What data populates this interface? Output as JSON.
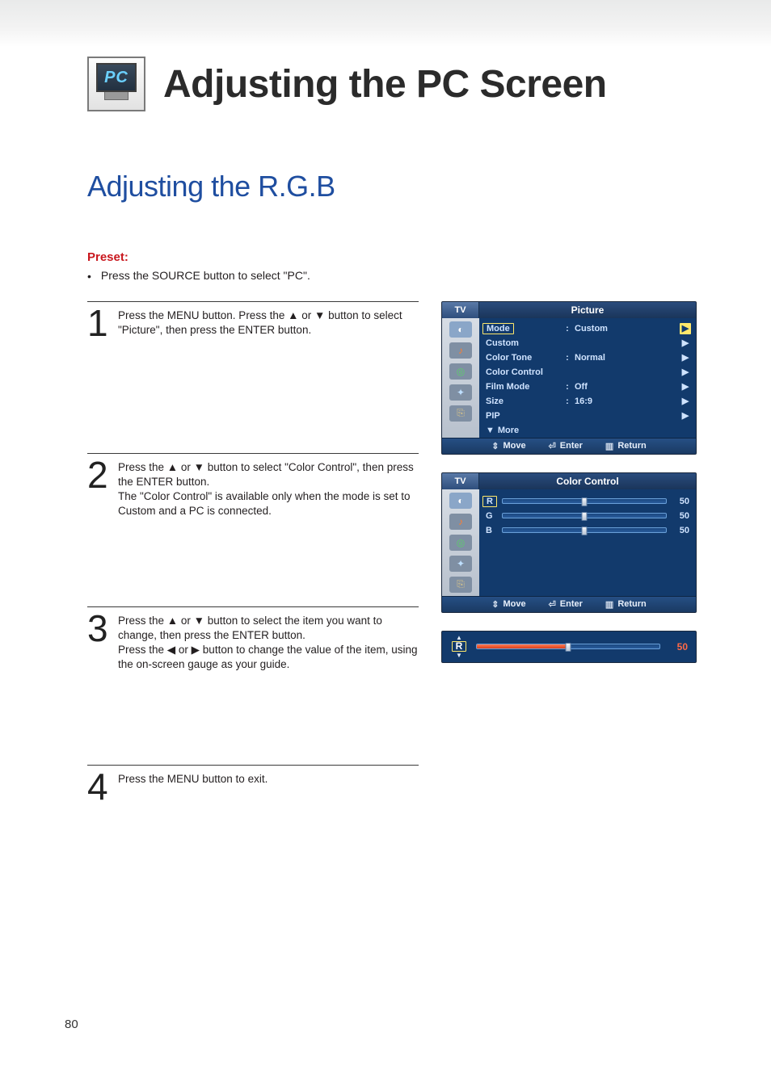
{
  "header": {
    "badge_text": "PC",
    "main_title": "Adjusting the PC Screen"
  },
  "sub_title": "Adjusting the R.G.B",
  "preset": {
    "label": "Preset:",
    "bullet": "Press the SOURCE button to select \"PC\"."
  },
  "steps": {
    "s1": {
      "num": "1",
      "text": "Press the MENU button. Press the ▲ or ▼ button to select \"Picture\", then press the ENTER button."
    },
    "s2": {
      "num": "2",
      "text": "Press the ▲ or ▼ button to select \"Color Control\", then press the ENTER button.\nThe \"Color Control\" is available only when the mode is set to Custom and a PC is connected."
    },
    "s3": {
      "num": "3",
      "text": "Press the ▲ or ▼ button to select the item you want to change, then press the ENTER button.\nPress the ◀ or ▶ button to change the value of the item, using the on-screen gauge as your guide."
    },
    "s4": {
      "num": "4",
      "text": "Press the MENU button to exit."
    }
  },
  "osd_picture": {
    "tv": "TV",
    "title": "Picture",
    "rows": {
      "mode": {
        "label": "Mode",
        "value": "Custom",
        "colon": ":"
      },
      "custom": {
        "label": "Custom",
        "value": "",
        "colon": ""
      },
      "color_tone": {
        "label": "Color Tone",
        "value": "Normal",
        "colon": ":"
      },
      "color_ctrl": {
        "label": "Color Control",
        "value": "",
        "colon": ""
      },
      "film_mode": {
        "label": "Film Mode",
        "value": "Off",
        "colon": ":"
      },
      "size": {
        "label": "Size",
        "value": "16:9",
        "colon": ":"
      },
      "pip": {
        "label": "PIP",
        "value": "",
        "colon": ""
      },
      "more": {
        "label": "More",
        "value": "",
        "colon": ""
      }
    },
    "footer": {
      "move": "Move",
      "enter": "Enter",
      "ret": "Return"
    }
  },
  "osd_color": {
    "tv": "TV",
    "title": "Color Control",
    "rows": {
      "r": {
        "label": "R",
        "value": "50",
        "pct": 50
      },
      "g": {
        "label": "G",
        "value": "50",
        "pct": 50
      },
      "b": {
        "label": "B",
        "value": "50",
        "pct": 50
      }
    },
    "footer": {
      "move": "Move",
      "enter": "Enter",
      "ret": "Return"
    }
  },
  "adjust_bar": {
    "label": "R",
    "value": "50",
    "pct": 50
  },
  "page_number": "80"
}
